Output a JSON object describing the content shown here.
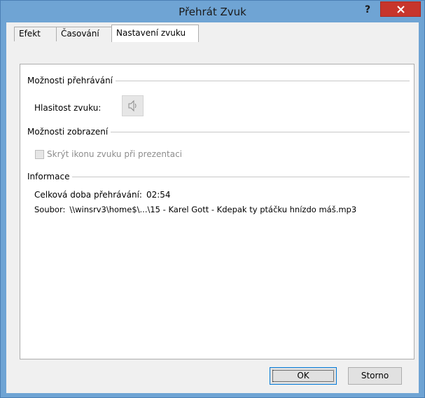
{
  "window": {
    "title": "Přehrát Zvuk",
    "help_label": "?",
    "colors": {
      "titlebar": "#6fa4d4",
      "close": "#c7352c",
      "client": "#f0f0f0"
    }
  },
  "tabs": [
    {
      "label": "Efekt",
      "active": false
    },
    {
      "label": "Časování",
      "active": false
    },
    {
      "label": "Nastavení zvuku",
      "active": true
    }
  ],
  "playback": {
    "header": "Možnosti přehrávání",
    "volume_label": "Hlasitost zvuku:",
    "volume_icon": "speaker-icon"
  },
  "display": {
    "header": "Možnosti zobrazení",
    "hide_icon_label": "Skrýt ikonu zvuku při prezentaci",
    "hide_icon_checked": false,
    "hide_icon_enabled": false
  },
  "info": {
    "header": "Informace",
    "duration_label": "Celková doba přehrávání:",
    "duration_value": "02:54",
    "file_label": "Soubor:",
    "file_value": "\\\\winsrv3\\home$\\...\\15 - Karel Gott - Kdepak ty ptáčku hnízdo máš.mp3"
  },
  "buttons": {
    "ok": "OK",
    "cancel": "Storno"
  }
}
